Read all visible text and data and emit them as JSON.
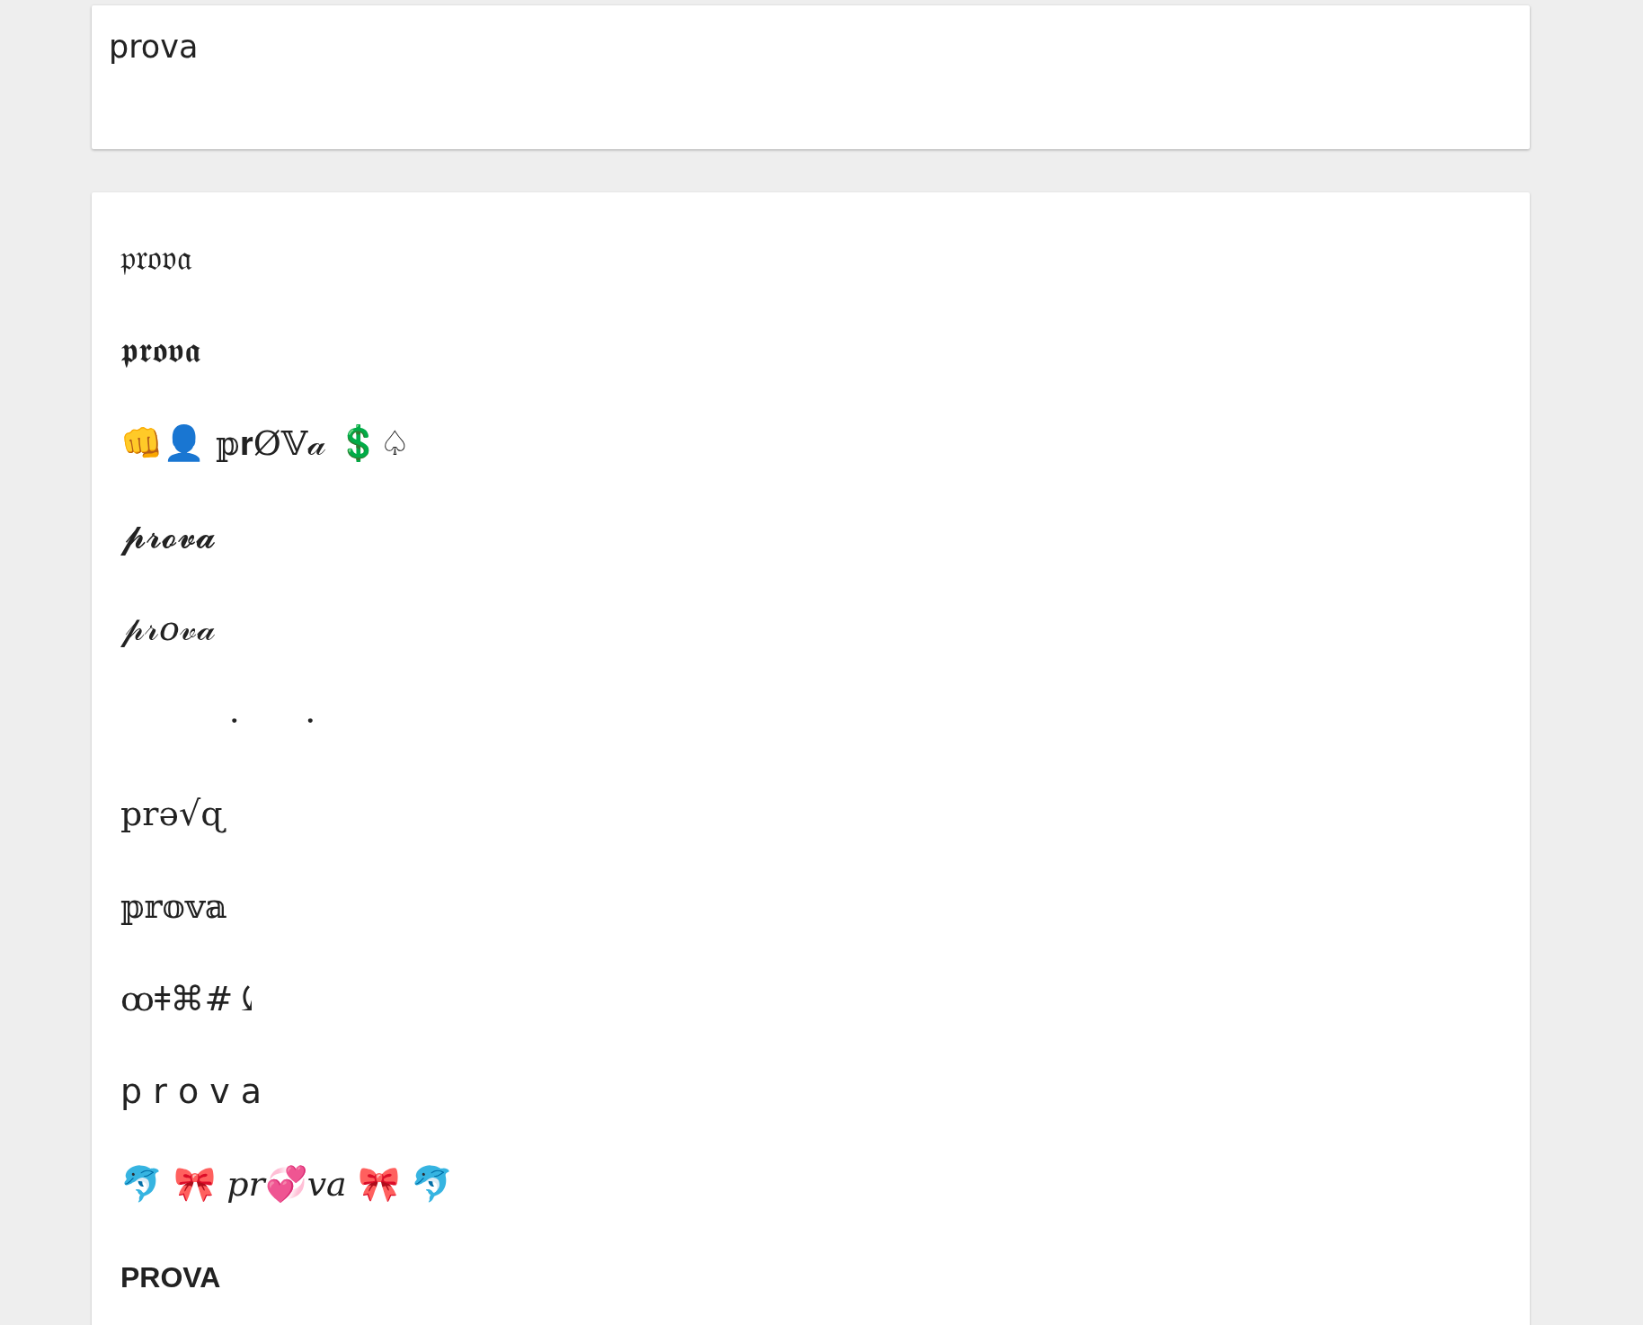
{
  "input": {
    "value": "prova"
  },
  "results": [
    {
      "kind": "unicode",
      "text": "𝔭𝔯𝔬𝔳𝔞"
    },
    {
      "kind": "unicode",
      "text": "𝖕𝖗𝖔𝖛𝖆"
    },
    {
      "kind": "unicode",
      "text": "👊👤 𝕡𝐫Ø𝕍𝒶 💲♤"
    },
    {
      "kind": "unicode",
      "text": "𝓹𝓻𝓸𝓿𝓪"
    },
    {
      "kind": "unicode",
      "text": "𝓅𝓇𝑜𝓋𝒶"
    },
    {
      "kind": "unicode",
      "text": "          ·      ·"
    },
    {
      "kind": "unicode",
      "text": "prə√ɋ"
    },
    {
      "kind": "unicode",
      "text": "𝕡𝕣𝕠𝕧𝕒"
    },
    {
      "kind": "unicode",
      "text": "ꝏǂ⌘#⤹"
    },
    {
      "kind": "sans",
      "text": "p r o v a"
    },
    {
      "kind": "unicode",
      "text": "🐬 🎀 𝑝𝑟💞𝑣𝑎 🎀 🐬"
    },
    {
      "kind": "bold",
      "text": "PROVA"
    }
  ]
}
